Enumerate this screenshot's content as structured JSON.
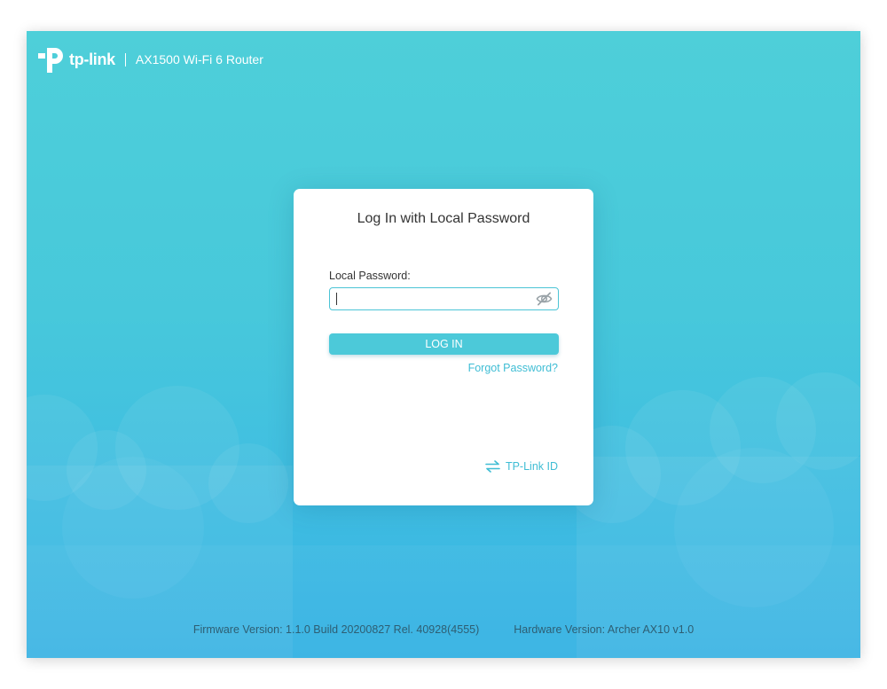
{
  "brand": {
    "logo_text": "tp-link",
    "model": "AX1500 Wi-Fi 6 Router"
  },
  "login": {
    "title": "Log In with Local Password",
    "password_label": "Local Password:",
    "password_value": "",
    "login_button": "LOG IN",
    "forgot_link": "Forgot Password?",
    "tplink_id_link": "TP-Link ID"
  },
  "footer": {
    "firmware": "Firmware Version: 1.1.0 Build 20200827 Rel. 40928(4555)",
    "hardware": "Hardware Version: Archer AX10 v1.0"
  },
  "icons": {
    "logo": "tp-link-logo-icon",
    "password_toggle": "eye-slash-icon",
    "tplink_id": "swap-arrows-icon"
  },
  "colors": {
    "background_top": "#4ecfd9",
    "background_bottom": "#36b2e3",
    "accent": "#4cc9d9",
    "link": "#3fbdd4",
    "footer_text": "#2e5e73"
  }
}
